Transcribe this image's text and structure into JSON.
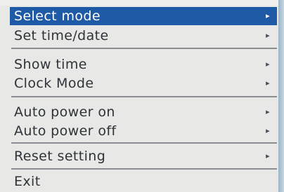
{
  "menu": {
    "items": [
      {
        "label": "Select mode",
        "arrow": "▸",
        "selected": true
      },
      {
        "label": "Set time/date",
        "arrow": "▸"
      },
      {
        "label": "Show time",
        "arrow": "▸"
      },
      {
        "label": "Clock Mode",
        "arrow": "▸"
      },
      {
        "label": "Auto power on",
        "arrow": "▸"
      },
      {
        "label": "Auto power off",
        "arrow": "▸"
      },
      {
        "label": "Reset setting",
        "arrow": "▸"
      },
      {
        "label": "Exit"
      }
    ],
    "selected_color": "#1f5aa6",
    "text_color": "#2e3338",
    "background_color": "#e8e8e6"
  }
}
